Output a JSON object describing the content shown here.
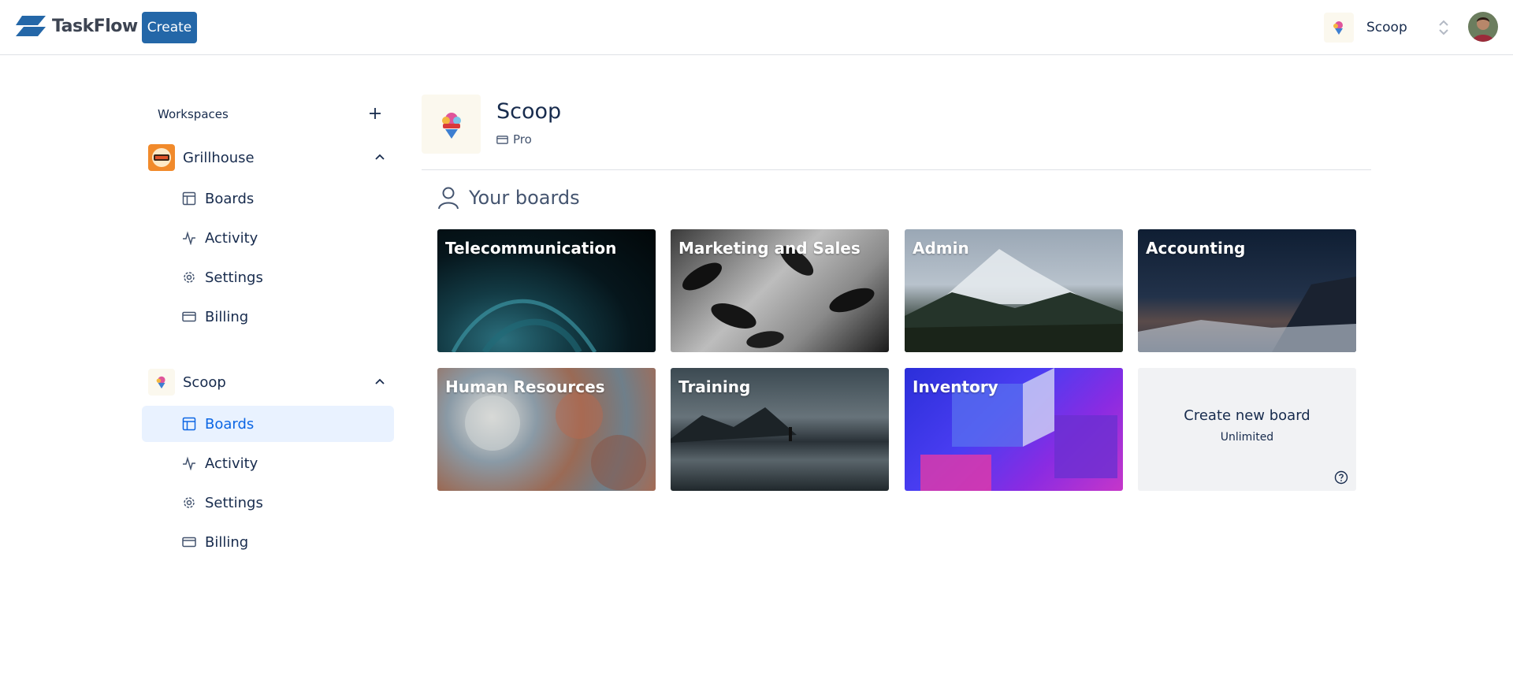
{
  "app": {
    "name": "TaskFlow",
    "create_label": "Create"
  },
  "header": {
    "workspace_name": "Scoop"
  },
  "sidebar": {
    "heading": "Workspaces",
    "workspaces": [
      {
        "name": "Grillhouse",
        "items": [
          "Boards",
          "Activity",
          "Settings",
          "Billing"
        ]
      },
      {
        "name": "Scoop",
        "items": [
          "Boards",
          "Activity",
          "Settings",
          "Billing"
        ],
        "active_item": "Boards"
      }
    ]
  },
  "main": {
    "title": "Scoop",
    "plan": "Pro",
    "boards_heading": "Your boards",
    "boards": [
      {
        "name": "Telecommunication"
      },
      {
        "name": "Marketing and Sales"
      },
      {
        "name": "Admin"
      },
      {
        "name": "Accounting"
      },
      {
        "name": "Human Resources"
      },
      {
        "name": "Training"
      },
      {
        "name": "Inventory"
      }
    ],
    "new_board": {
      "title": "Create new board",
      "subtitle": "Unlimited"
    }
  },
  "colors": {
    "primary": "#2467a8",
    "active_bg": "#e9f2ff",
    "active_text": "#0c66e4",
    "tile_empty": "#f1f2f4"
  }
}
